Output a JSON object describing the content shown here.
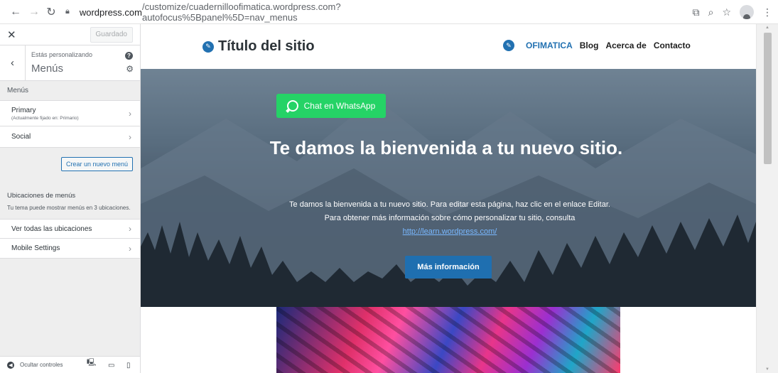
{
  "browser": {
    "url_host": "wordpress.com",
    "url_path": "/customize/cuadernilloofimatica.wordpress.com?autofocus%5Bpanel%5D=nav_menus"
  },
  "sidebar": {
    "saved_label": "Guardado",
    "customizing_label": "Estás personalizando",
    "panel_title": "Menús",
    "section_title": "Menús",
    "menus": [
      {
        "label": "Primary",
        "sub": "(Actualmente fijado en: Primario)"
      },
      {
        "label": "Social",
        "sub": ""
      }
    ],
    "create_menu_label": "Crear un nuevo menú",
    "locations_title": "Ubicaciones de menús",
    "locations_desc": "Tu tema puede mostrar menús en 3 ubicaciones.",
    "view_all_locations": "Ver todas las ubicaciones",
    "mobile_settings": "Mobile Settings",
    "hide_controls_label": "Ocultar controles"
  },
  "site": {
    "title": "Título del sitio",
    "nav": [
      "OFIMATICA",
      "Blog",
      "Acerca de",
      "Contacto"
    ],
    "whatsapp_label": "Chat en WhatsApp",
    "hero_title": "Te damos la bienvenida a tu nuevo sitio.",
    "hero_text_1": "Te damos la bienvenida a tu nuevo sitio. Para editar esta página, haz clic en el enlace Editar.",
    "hero_text_2": "Para obtener más información sobre cómo personalizar tu sitio, consulta",
    "hero_link": "http://learn.wordpress.com/",
    "hero_button": "Más información"
  },
  "colors": {
    "accent": "#2271b1",
    "whatsapp": "#25d366"
  }
}
